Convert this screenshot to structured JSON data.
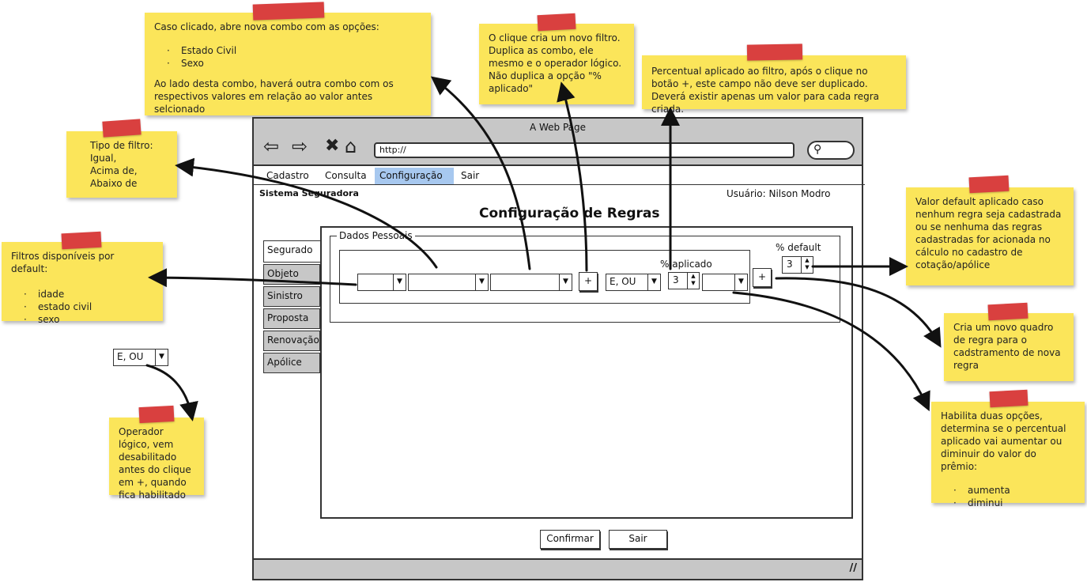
{
  "window": {
    "title": "A Web Page",
    "url": "http://",
    "menu": [
      "Cadastro",
      "Consulta",
      "Configuração",
      "Sair"
    ],
    "active_menu": "Configuração",
    "system_name": "Sistema Seguradora",
    "user": "Usuário: Nilson Modro",
    "page_title": "Configuração de Regras"
  },
  "tabs": [
    "Segurado",
    "Objeto",
    "Sinistro",
    "Proposta",
    "Renovação",
    "Apólice"
  ],
  "active_tab": "Segurado",
  "form": {
    "group_label": "Dados Pessoais",
    "logic_combo": "E, OU",
    "percent_applied_label": "% aplicado",
    "percent_applied_value": "3",
    "add_filter": "+",
    "percent_default_label": "% default",
    "percent_default_value": "3",
    "add_rule": "+"
  },
  "buttons": {
    "confirm": "Confirmar",
    "exit": "Sair"
  },
  "standalone_combo": "E, OU",
  "notes": {
    "combo_note": {
      "intro": "Caso clicado, abre nova combo com as opções:",
      "items": [
        "Estado Civil",
        "Sexo"
      ],
      "footer": "Ao lado desta combo, haverá outra combo com os respectivos valores em relação ao valor antes selcionado"
    },
    "filter_note": "O clique cria um novo filtro. Duplica as combo, ele mesmo e o operador lógico. Não duplica a opção \"% aplicado\"",
    "percent_note": "Percentual aplicado ao filtro, após o clique no botão +, este campo não deve ser duplicado. Deverá existir apenas um valor para cada regra criada.",
    "type_note": {
      "title": "Tipo de filtro:",
      "items": [
        "Igual,",
        "Acima de,",
        "Abaixo de"
      ]
    },
    "default_filters_note": {
      "title": "Filtros disponíveis por default:",
      "items": [
        "idade",
        "estado civil",
        "sexo"
      ]
    },
    "default_value_note": "Valor default aplicado caso nenhum regra seja cadastrada ou se nenhuma das regras cadastradas for acionada no cálculo no cadastro de cotação/apólice",
    "new_rule_note": "Cria um novo quadro de regra para o cadstramento de nova regra",
    "operator_note": "Operador lógico, vem desabilitado antes do clique em +, quando fica habilitado",
    "options_note": {
      "title": "Habilita duas opções, determina se o percentual aplicado vai aumentar ou diminuir do valor do prêmio:",
      "items": [
        "aumenta",
        "diminui"
      ]
    }
  },
  "colors": {
    "note": "#fbe55a",
    "tape": "#d9403f",
    "chrome": "#c7c7c7",
    "active_menu": "#a7c8ef"
  }
}
